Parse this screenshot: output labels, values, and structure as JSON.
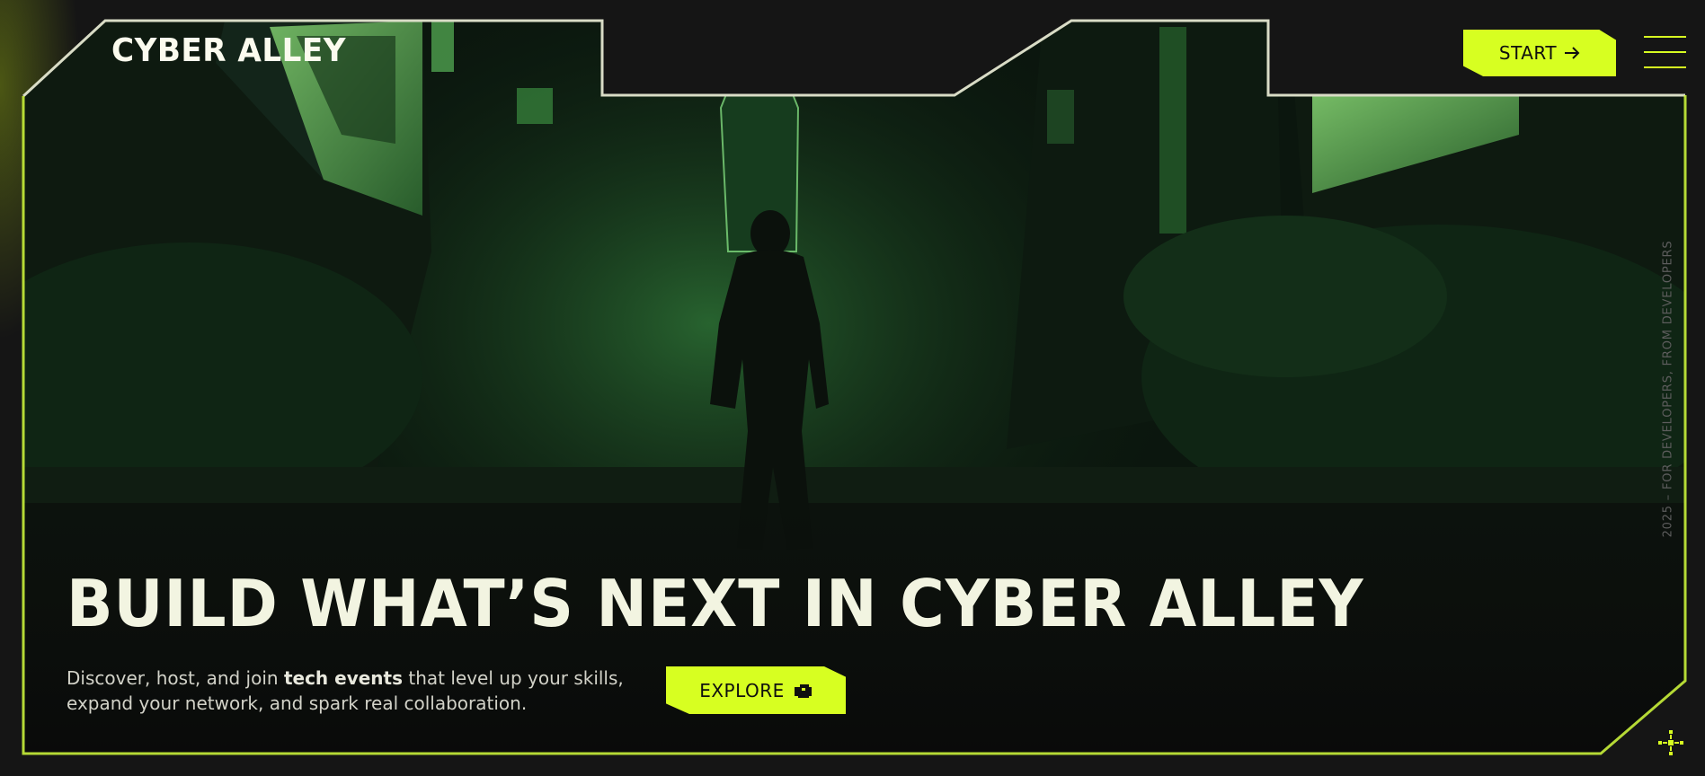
{
  "brand": {
    "name": "CYBER ALLEY"
  },
  "header": {
    "start_label": "START",
    "start_icon": "arrow-right-icon",
    "menu_icon": "hamburger-menu-icon"
  },
  "hero": {
    "headline": "BUILD WHAT’S NEXT IN CYBER ALLEY",
    "subtext_before": "Discover, host, and join ",
    "subtext_strong": "tech events",
    "subtext_after": " that level up your skills, expand your network, and spark real collaboration.",
    "explore_label": "EXPLORE",
    "explore_icon": "pixel-hand-icon",
    "background_image": "dark-green-cyberpunk-city-street-with-hooded-figure"
  },
  "side_caption": "2025 – FOR DEVELOPERS, FROM DEVELOPERS",
  "corner_icon": "move-crosshair-icon",
  "colors": {
    "accent": "#d7ff21",
    "background": "#151515",
    "headline": "#f2f4e1",
    "caption": "#5d5d5d"
  }
}
